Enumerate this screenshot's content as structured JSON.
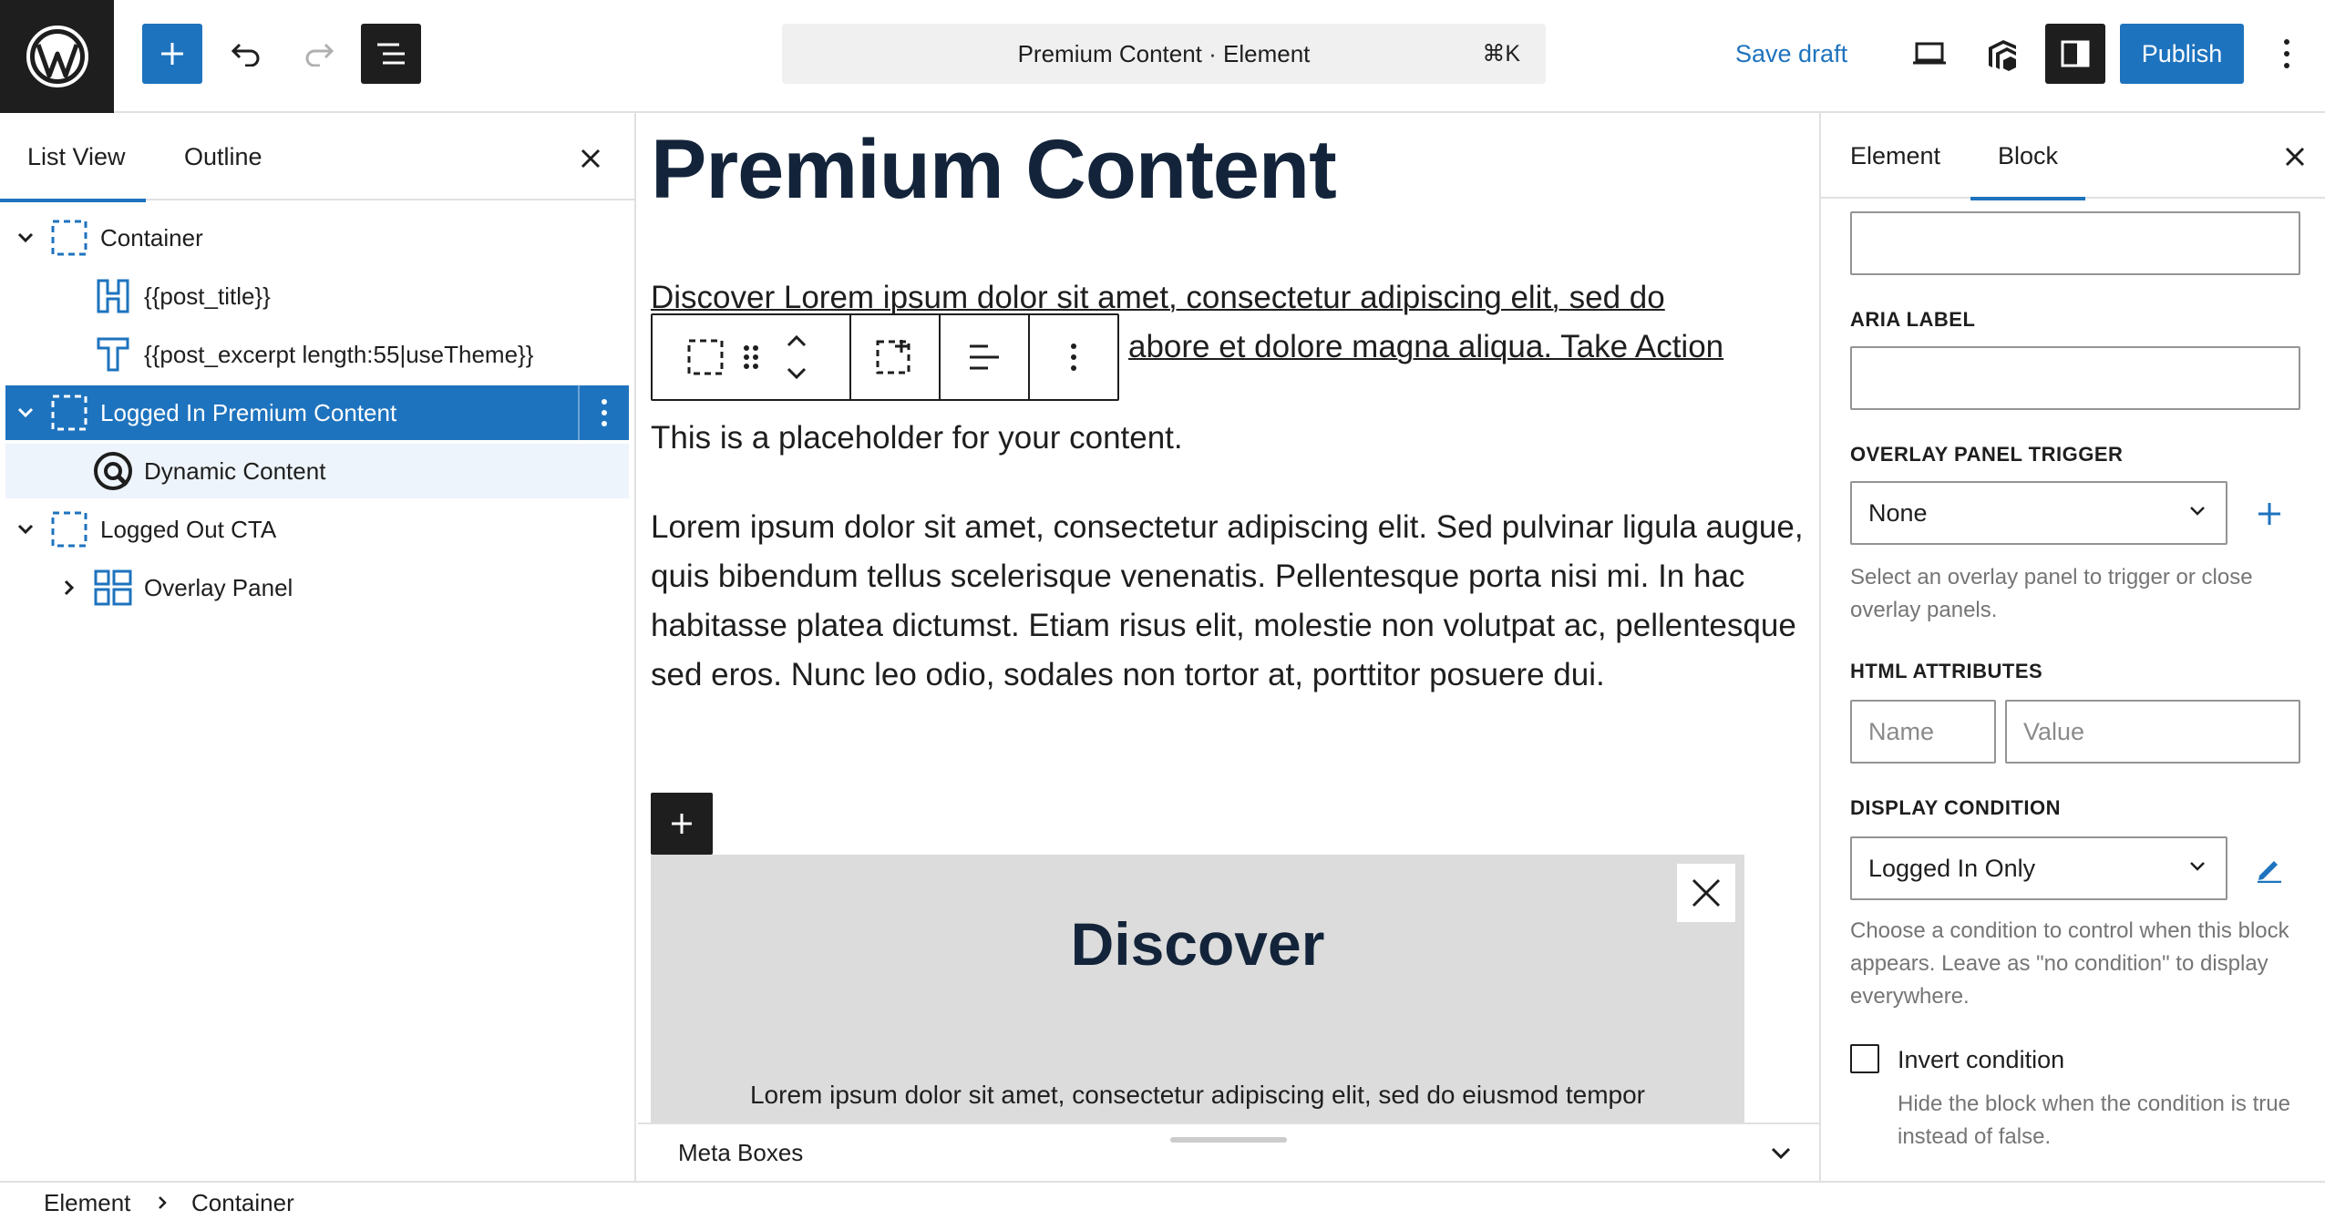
{
  "topbar": {
    "command_bar_title": "Premium Content · Element",
    "command_shortcut": "⌘K",
    "save_draft": "Save draft",
    "publish": "Publish"
  },
  "list_view": {
    "tabs": [
      {
        "label": "List View",
        "active": true
      },
      {
        "label": "Outline",
        "active": false
      }
    ],
    "items": [
      {
        "label": "Container",
        "icon": "container-icon",
        "expanded": true,
        "depth": 0
      },
      {
        "label": "{{post_title}}",
        "icon": "heading-icon",
        "depth": 1
      },
      {
        "label": "{{post_excerpt length:55|useTheme}}",
        "icon": "text-icon",
        "depth": 1
      },
      {
        "label": "Logged In Premium Content",
        "icon": "container-icon",
        "expanded": true,
        "depth": 0,
        "selected": true
      },
      {
        "label": "Dynamic Content",
        "icon": "dynamic-content-icon",
        "depth": 1
      },
      {
        "label": "Logged Out CTA",
        "icon": "container-icon",
        "expanded": true,
        "depth": 0
      },
      {
        "label": "Overlay Panel",
        "icon": "overlay-panel-icon",
        "expanded": false,
        "depth": 1
      }
    ]
  },
  "canvas": {
    "title": "Premium Content",
    "paragraph_1_line_1": "Discover Lorem ipsum dolor sit amet, consectetur adipiscing elit, sed do",
    "paragraph_1_line_2": "abore et dolore magna aliqua. Take Action",
    "paragraph_2": "This is a placeholder for your content.",
    "paragraph_3": "Lorem ipsum dolor sit amet, consectetur adipiscing elit. Sed pulvinar ligula augue, quis bibendum tellus scelerisque venenatis. Pellentesque porta nisi mi. In hac habitasse platea dictumst. Etiam risus elit, molestie non volutpat ac, pellentesque sed eros. Nunc leo odio, sodales non tortor at, porttitor posuere dui.",
    "overlay_title": "Discover",
    "overlay_text": "Lorem ipsum dolor sit amet, consectetur adipiscing elit, sed do eiusmod tempor",
    "meta_boxes": "Meta Boxes"
  },
  "sidebar": {
    "tabs": [
      {
        "label": "Element",
        "active": false
      },
      {
        "label": "Block",
        "active": true
      }
    ],
    "aria_label": {
      "label": "ARIA LABEL",
      "value": ""
    },
    "overlay_trigger": {
      "label": "OVERLAY PANEL TRIGGER",
      "selected": "None",
      "help": "Select an overlay panel to trigger or close overlay panels."
    },
    "html_attributes": {
      "label": "HTML ATTRIBUTES",
      "name_placeholder": "Name",
      "value_placeholder": "Value"
    },
    "display_condition": {
      "label": "DISPLAY CONDITION",
      "selected": "Logged In Only",
      "help": "Choose a condition to control when this block appears. Leave as \"no condition\" to display everywhere."
    },
    "invert_condition": {
      "label": "Invert condition",
      "checked": false,
      "help": "Hide the block when the condition is true instead of false."
    }
  },
  "breadcrumb": [
    "Element",
    "Container"
  ],
  "colors": {
    "accent": "#1e73be",
    "dark": "#1e1e1e",
    "title": "#13243a"
  }
}
